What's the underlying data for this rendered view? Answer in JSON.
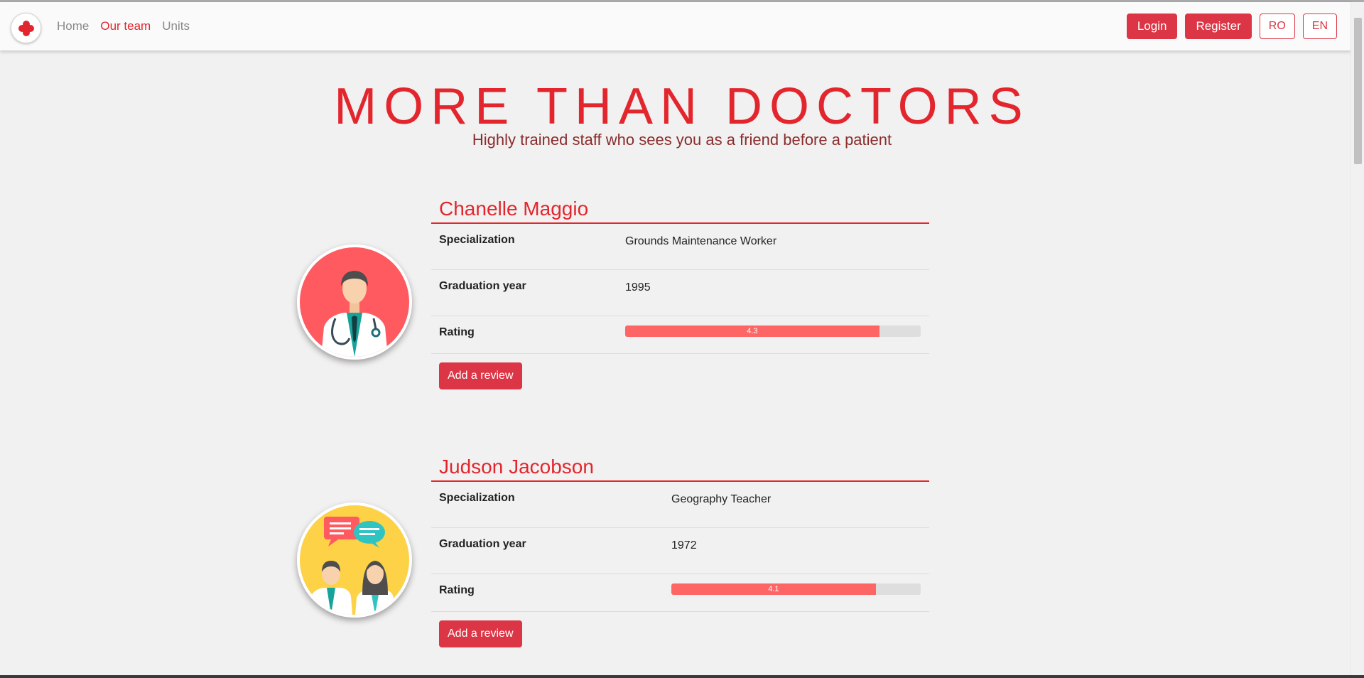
{
  "nav": {
    "links": [
      "Home",
      "Our team",
      "Units"
    ],
    "active_index": 1,
    "login": "Login",
    "register": "Register",
    "lang_ro": "RO",
    "lang_en": "EN"
  },
  "hero": {
    "title": "MORE THAN DOCTORS",
    "subtitle": "Highly trained staff who sees you as a friend before a patient"
  },
  "row_labels": {
    "specialization": "Specialization",
    "graduation_year": "Graduation year",
    "rating": "Rating"
  },
  "review_button": "Add a review",
  "doctors": [
    {
      "name": "Chanelle Maggio",
      "specialization": "Grounds Maintenance Worker",
      "graduation_year": "1995",
      "rating": "4.3",
      "rating_fraction": 0.86,
      "avatar": "doctor-man-icon",
      "avatar_bg": "#fe5a5f"
    },
    {
      "name": "Judson Jacobson",
      "specialization": "Geography Teacher",
      "graduation_year": "1972",
      "rating": "4.1",
      "rating_fraction": 0.82,
      "avatar": "doctors-chat-icon",
      "avatar_bg": "#fdd247"
    }
  ],
  "colors": {
    "accent": "#e3262d",
    "button": "#dc3545",
    "rating_bar": "#fe6666"
  }
}
